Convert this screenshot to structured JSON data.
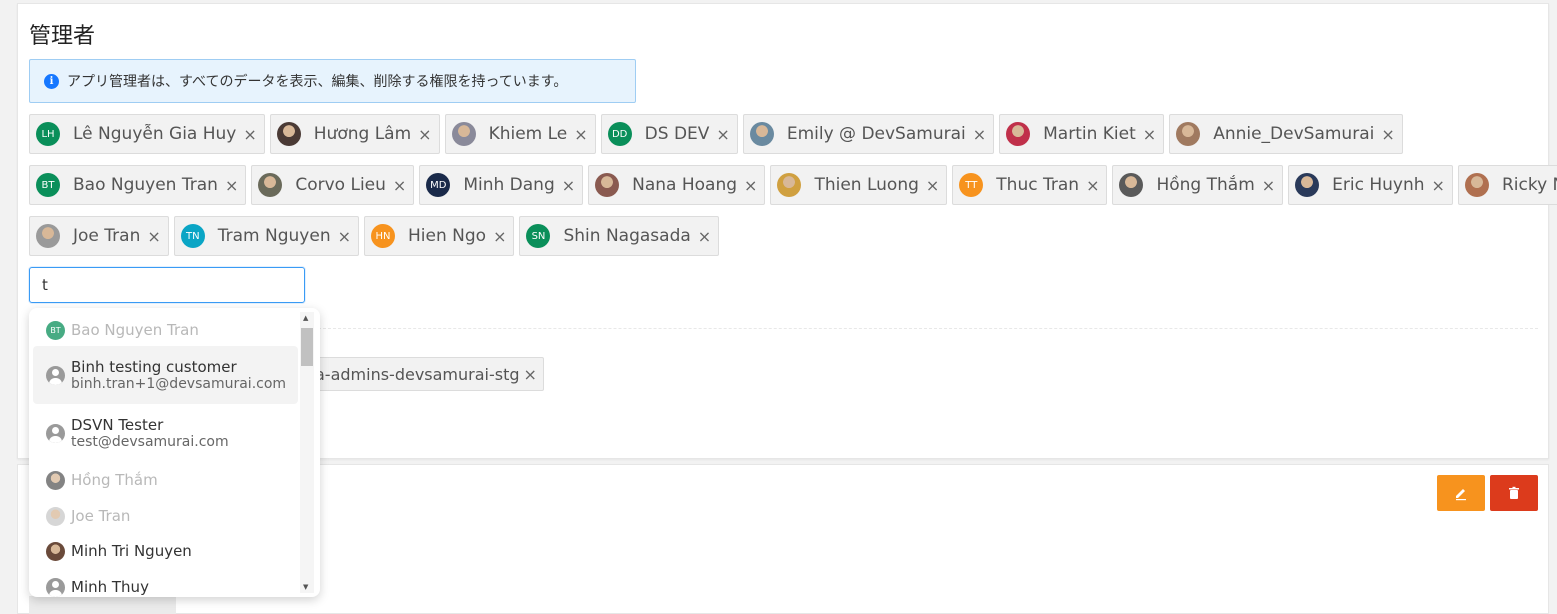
{
  "title": "管理者",
  "info_text": "アプリ管理者は、すべてのデータを表示、編集、削除する権限を持っています。",
  "tag_rows": [
    [
      {
        "name": "Lê Nguyễn Gia Huy",
        "initials": "LH",
        "color": "#0a8f5a"
      },
      {
        "name": "Hương Lâm",
        "initials": "",
        "color": "#4a3a35"
      },
      {
        "name": "Khiem Le",
        "initials": "",
        "color": "#8a8a9a"
      },
      {
        "name": "DS DEV",
        "initials": "DD",
        "color": "#0a8f5a"
      },
      {
        "name": "Emily @ DevSamurai",
        "initials": "",
        "color": "#6a8aa0"
      },
      {
        "name": "Martin Kiet",
        "initials": "",
        "color": "#c0304a"
      },
      {
        "name": "Annie_DevSamurai",
        "initials": "",
        "color": "#a07a60"
      }
    ],
    [
      {
        "name": "Bao Nguyen Tran",
        "initials": "BT",
        "color": "#0a8f5a"
      },
      {
        "name": "Corvo Lieu",
        "initials": "",
        "color": "#6a6a5a"
      },
      {
        "name": "Minh Dang",
        "initials": "MD",
        "color": "#1a2a4a"
      },
      {
        "name": "Nana Hoang",
        "initials": "",
        "color": "#8a5a50"
      },
      {
        "name": "Thien Luong",
        "initials": "",
        "color": "#d0a040"
      },
      {
        "name": "Thuc Tran",
        "initials": "TT",
        "color": "#f7931e"
      },
      {
        "name": "Hồng Thắm",
        "initials": "",
        "color": "#5a5a5a"
      },
      {
        "name": "Eric Huynh",
        "initials": "",
        "color": "#2a3a5a"
      },
      {
        "name": "Ricky Ng",
        "initials": "",
        "color": "#b07050"
      }
    ],
    [
      {
        "name": "Joe Tran",
        "initials": "",
        "color": "#9a9a9a"
      },
      {
        "name": "Tram Nguyen",
        "initials": "TN",
        "color": "#0aa5c5"
      },
      {
        "name": "Hien Ngo",
        "initials": "HN",
        "color": "#f7931e"
      },
      {
        "name": "Shin Nagasada",
        "initials": "SN",
        "color": "#0a8f5a"
      }
    ]
  ],
  "search_value": "t",
  "group_tag": "a-admins-devsamurai-stg",
  "close_glyph": "×",
  "dropdown": [
    {
      "name": "Bao Nguyen Tran",
      "sub": "",
      "initials": "BT",
      "color": "#0a8f5a",
      "disabled": true
    },
    {
      "name": "Binh testing customer",
      "sub": "binh.tran+1@devsamurai.com",
      "initials": "",
      "color": "user-icon",
      "disabled": false,
      "active": true
    },
    {
      "name": "DSVN Tester",
      "sub": "test@devsamurai.com",
      "initials": "",
      "color": "user-icon",
      "disabled": false
    },
    {
      "name": "Hồng Thắm",
      "sub": "",
      "initials": "",
      "color": "#5a5a5a",
      "disabled": true
    },
    {
      "name": "Joe Tran",
      "sub": "",
      "initials": "",
      "color": "#c8c8c8",
      "disabled": true
    },
    {
      "name": "Minh Tri Nguyen",
      "sub": "",
      "initials": "",
      "color": "#6a4a3a",
      "disabled": false
    },
    {
      "name": "Minh Thuy",
      "sub": "",
      "initials": "",
      "color": "user-icon",
      "disabled": false
    }
  ],
  "icons": {
    "info": "i",
    "edit": "pencil-icon",
    "delete": "trash-icon"
  },
  "colors": {
    "accent": "#3a9bf5",
    "edit": "#f7931e",
    "delete": "#dc3b1c",
    "info_bg": "#e7f3fd"
  }
}
